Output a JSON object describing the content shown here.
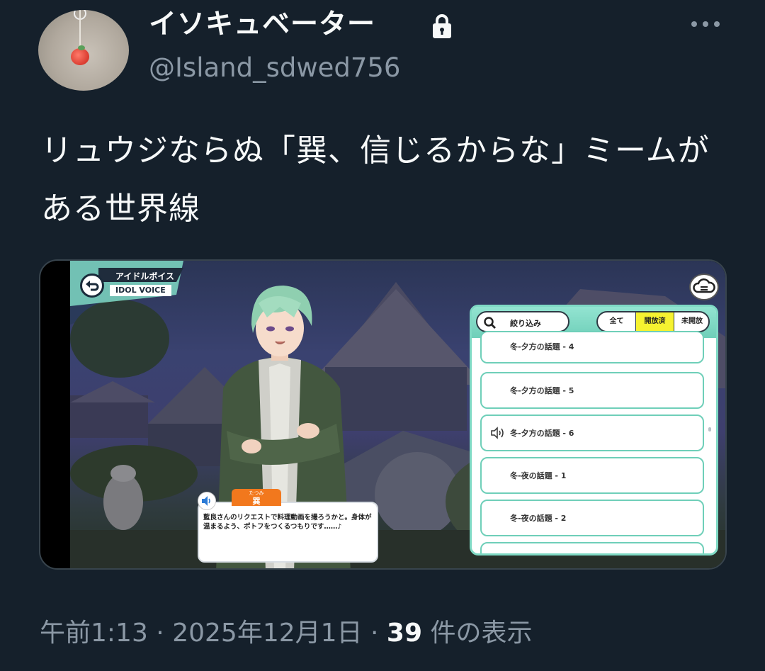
{
  "author": {
    "display_name": "イソキュベーター",
    "handle": "@Island_sdwed756",
    "protected_icon": "lock-icon",
    "avatar_icon": "peach-charm-avatar"
  },
  "tweet": {
    "text": "リュウジならぬ「巽、信じるからな」ミームがある世界線"
  },
  "media": {
    "header": {
      "title_ja": "アイドルボイス",
      "title_en": "IDOL VOICE"
    },
    "filter": {
      "label": "絞り込み"
    },
    "tabs": [
      {
        "label": "全て",
        "selected": false
      },
      {
        "label": "開放済",
        "selected": true
      },
      {
        "label": "未開放",
        "selected": false
      }
    ],
    "voice_items": [
      {
        "label": "冬-夕方の話題 - 4",
        "playing": false
      },
      {
        "label": "冬-夕方の話題 - 5",
        "playing": false
      },
      {
        "label": "冬-夕方の話題 - 6",
        "playing": true
      },
      {
        "label": "冬-夜の話題 - 1",
        "playing": false
      },
      {
        "label": "冬-夜の話題 - 2",
        "playing": false
      }
    ],
    "dialogue": {
      "speaker_furigana": "たつみ",
      "speaker": "巽",
      "text": "藍良さんのリクエストで料理動画を撮ろうかと。身体が温まるよう、ポトフをつくるつもりです……♪"
    },
    "accent_color": "#7fd9c4",
    "selected_tab_color": "#f6f230",
    "speaker_tag_color": "#f2781d"
  },
  "footer": {
    "time": "午前1:13",
    "separator": "·",
    "date": "2025年12月1日",
    "separator2": "·",
    "views_count": "39",
    "views_label": "件の表示"
  }
}
